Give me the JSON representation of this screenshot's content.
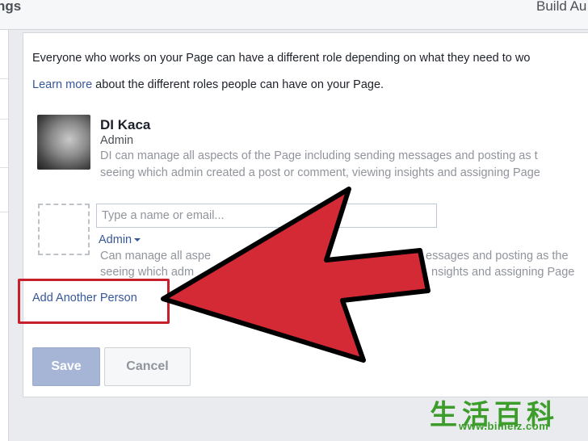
{
  "topbar": {
    "title": "ngs",
    "right_link": "Build Au"
  },
  "intro": {
    "line1": "Everyone who works on your Page can have a different role depending on what they need to wo",
    "learn_more": "Learn more",
    "line2_rest": " about the different roles people can have on your Page."
  },
  "admin": {
    "name": "DI Kaca",
    "role": "Admin",
    "desc1": "DI can manage all aspects of the Page including sending messages and posting as t",
    "desc2": "seeing which admin created a post or comment, viewing insights and assigning Page"
  },
  "new_person": {
    "input_placeholder": "Type a name or email...",
    "input_value": "",
    "role_selected": "Admin",
    "desc1": "Can manage all aspe",
    "desc1b": "essages and posting as the",
    "desc2": "seeing which adm",
    "desc2b": "nsights and assigning Page"
  },
  "add_person_link": "Add Another Person",
  "buttons": {
    "save": "Save",
    "cancel": "Cancel"
  },
  "annotation": {
    "arrow_color": "#d42a36",
    "arrow_outline": "#000000",
    "highlight_color": "#c8202a"
  },
  "watermark": {
    "chinese": "生活百科",
    "url": "www.bimeiz.com"
  }
}
